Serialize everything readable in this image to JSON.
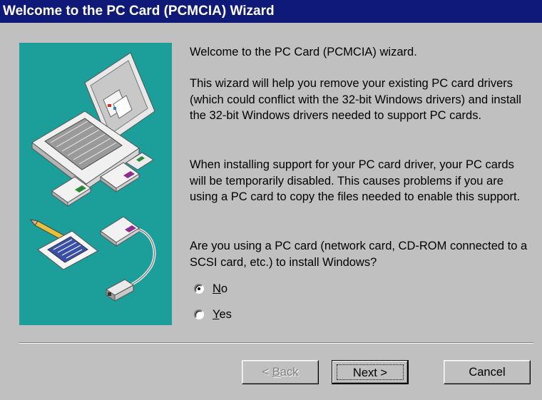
{
  "window": {
    "title": "Welcome to the PC Card (PCMCIA) Wizard"
  },
  "content": {
    "welcome": "Welcome to the PC Card (PCMCIA) wizard.",
    "help_text": "This wizard will help you remove your existing PC card drivers (which could conflict with the 32-bit Windows drivers) and install the 32-bit Windows drivers needed to support PC cards.",
    "install_text": "When installing support for your PC card driver, your PC cards will be temporarily disabled. This causes problems if you are using a PC card to copy the files needed to enable this support.",
    "question": "Are you using a PC card (network card, CD-ROM connected to a SCSI card, etc.) to install Windows?"
  },
  "options": {
    "no": {
      "mnemonic": "N",
      "rest": "o",
      "selected": true
    },
    "yes": {
      "mnemonic": "Y",
      "rest": "es",
      "selected": false
    }
  },
  "buttons": {
    "back": {
      "prefix": "< ",
      "mnemonic": "B",
      "rest": "ack",
      "enabled": false
    },
    "next": "Next >",
    "cancel": "Cancel"
  },
  "colors": {
    "title_bar": "#0f1a78",
    "illustration_bg": "#1c9e9b",
    "dialog_face": "#c0c0c0"
  },
  "icons": {
    "illustration": "laptop-pc-cards-illustration"
  }
}
